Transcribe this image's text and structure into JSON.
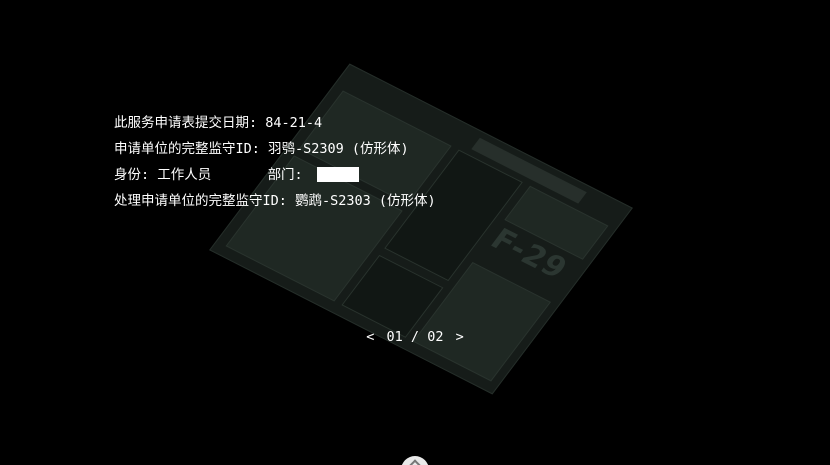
{
  "info": {
    "submit_date_label": "此服务申请表提交日期:",
    "submit_date_value": "84-21-4",
    "applicant_unit_label": "申请单位的完整监守ID:",
    "applicant_unit_value": "羽鸮-S2309 (仿形体)",
    "identity_label": "身份:",
    "identity_value": "工作人员",
    "department_label": "部门:",
    "department_value": "",
    "processing_unit_label": "处理申请单位的完整监守ID:",
    "processing_unit_value": "鹦鹉-S2303 (仿形体)"
  },
  "pager": {
    "prev_glyph": "<",
    "current": "01",
    "separator": "/",
    "total": "02",
    "next_glyph": ">"
  },
  "form": {
    "code": "F-29"
  },
  "icons": {
    "scroll_hint": "chevron-up-icon"
  },
  "colors": {
    "background": "#000000",
    "text": "#ffffff",
    "form_tint": "#1a221e"
  }
}
